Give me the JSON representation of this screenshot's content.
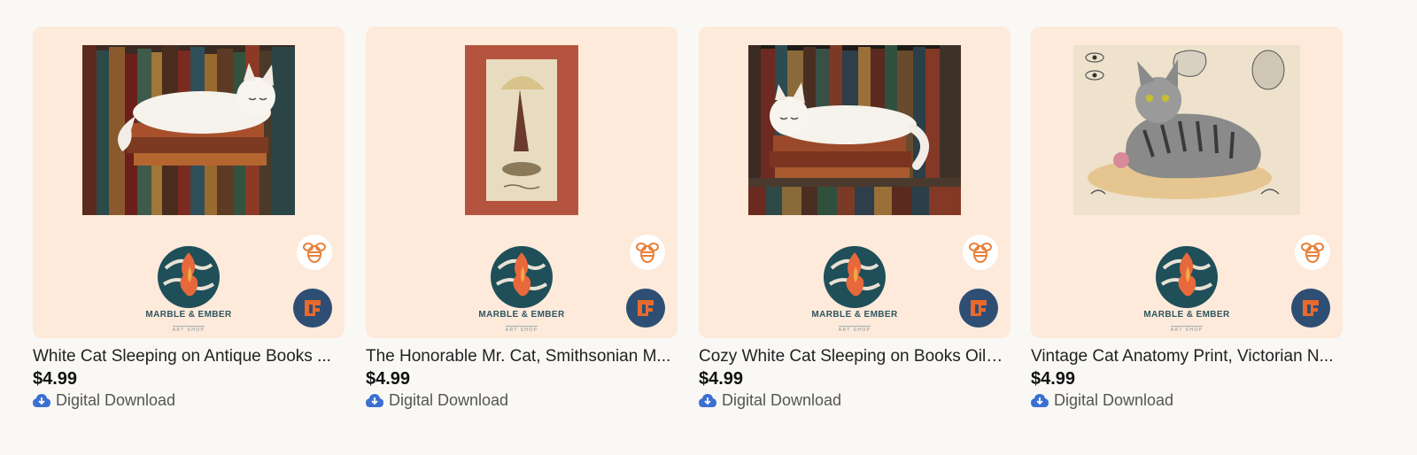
{
  "listings": [
    {
      "title": "White Cat Sleeping on Antique Books ...",
      "price": "$4.99",
      "delivery": "Digital Download",
      "shop_name": "MARBLE & EMBER",
      "shop_sub": "ART SHOP"
    },
    {
      "title": "The Honorable Mr. Cat, Smithsonian M...",
      "price": "$4.99",
      "delivery": "Digital Download",
      "shop_name": "MARBLE & EMBER",
      "shop_sub": "ART SHOP"
    },
    {
      "title": "Cozy White Cat Sleeping on Books Oil ...",
      "price": "$4.99",
      "delivery": "Digital Download",
      "shop_name": "MARBLE & EMBER",
      "shop_sub": "ART SHOP"
    },
    {
      "title": "Vintage Cat Anatomy Print, Victorian N...",
      "price": "$4.99",
      "delivery": "Digital Download",
      "shop_name": "MARBLE & EMBER",
      "shop_sub": "ART SHOP"
    }
  ],
  "icons": {
    "badge_top": "bee-icon",
    "badge_bottom": "etsy-shop-icon",
    "delivery": "download-cloud-icon"
  },
  "colors": {
    "card_background": "#fdeadb",
    "bee": "#e8803a",
    "etsy_badge": "#2e4e74",
    "download_icon": "#3b6fd1"
  }
}
